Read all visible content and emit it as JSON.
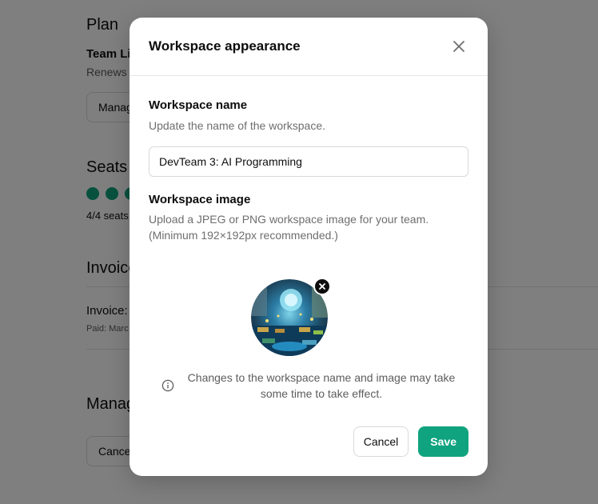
{
  "background": {
    "plan_heading": "Plan",
    "plan_name": "Team Li",
    "renews": "Renews o",
    "manage_btn": "Manag",
    "seats_heading": "Seats",
    "seats_count": "4/4 seats",
    "invoices_heading": "Invoice",
    "invoice_row": "Invoice:",
    "invoice_paid": "Paid: Marc",
    "manage_heading": "Manag",
    "cancel_btn": "Cancel"
  },
  "modal": {
    "title": "Workspace appearance",
    "name_label": "Workspace name",
    "name_desc": "Update the name of the workspace.",
    "name_value": "DevTeam 3: AI Programming",
    "image_label": "Workspace image",
    "image_desc_1": "Upload a JPEG or PNG workspace image for your team.",
    "image_desc_2": "(Minimum 192×192px recommended.)",
    "notice": "Changes to the workspace name and image may take some time to take effect.",
    "cancel_label": "Cancel",
    "save_label": "Save"
  },
  "icons": {
    "close": "close-icon",
    "remove": "remove-image-icon",
    "info": "info-icon"
  },
  "colors": {
    "accent": "#10a37f",
    "overlay": "rgba(0,0,0,0.5)",
    "text_muted": "#6e6e6e"
  }
}
